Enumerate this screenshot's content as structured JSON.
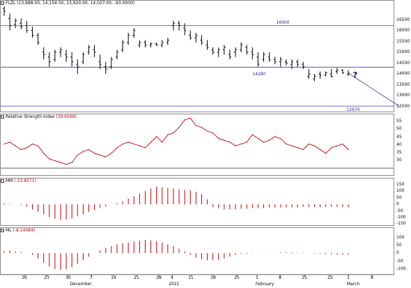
{
  "panels": [
    {
      "title_label": "FLZL",
      "title_value": "(13,988.00, 14,154.50, 13,920.00, 14,027.00, -93.0000)",
      "y_ticks": [
        "16500",
        "16000",
        "15500",
        "15000",
        "14500",
        "14000",
        "13500",
        "13000",
        "12500"
      ]
    },
    {
      "title_label": "Relative Strength Index",
      "title_value": "(39.6568)",
      "y_ticks": [
        "55",
        "50",
        "45",
        "40",
        "35",
        "30"
      ]
    },
    {
      "title_label": "MM",
      "title_value": "(-23.8571)",
      "y_ticks": [
        "150",
        "100",
        "50",
        "0",
        "-50",
        "-100",
        "-150"
      ]
    },
    {
      "title_label": "ML",
      "title_value": "(-8.14084)",
      "y_ticks": [
        "100",
        "50",
        "0",
        "-50",
        "-100"
      ]
    }
  ],
  "x_tick_labels": [
    "16",
    "23",
    "30",
    "7",
    "14",
    "21",
    "28",
    "4",
    "11",
    "18",
    "25",
    "1",
    "8",
    "15",
    "22",
    "1",
    "8"
  ],
  "month_labels": [
    "December",
    "2021",
    "February",
    "March"
  ],
  "annotations": {
    "level_high": "16000",
    "level_mid": "14280",
    "target": "12670",
    "question": "?"
  },
  "colors": {
    "price_bars": "#000000",
    "level_lines": "#3a3aa8",
    "rsi_line": "#c00000",
    "histogram": "#c00000",
    "annotation_text": "#1f1fa0",
    "question_mark": "#000080",
    "trend_line": "#3a3aa8"
  },
  "chart_data": [
    {
      "type": "ohlc",
      "title": "FLZL",
      "ylim": [
        12500,
        16800
      ],
      "x_index_range": [
        0,
        61
      ],
      "ohlc": [
        [
          16700,
          16850,
          16400,
          16600
        ],
        [
          16300,
          16500,
          15800,
          16000
        ],
        [
          16050,
          16300,
          15900,
          16200
        ],
        [
          16100,
          16300,
          15850,
          15950
        ],
        [
          16000,
          16200,
          15700,
          15800
        ],
        [
          15800,
          15950,
          15500,
          15600
        ],
        [
          15600,
          15700,
          15200,
          15300
        ],
        [
          14900,
          15100,
          14600,
          14800
        ],
        [
          14700,
          14900,
          14300,
          14500
        ],
        [
          14600,
          15000,
          14500,
          14900
        ],
        [
          14900,
          15100,
          14700,
          15000
        ],
        [
          14800,
          15000,
          14500,
          14700
        ],
        [
          14700,
          14900,
          14300,
          14500
        ],
        [
          14400,
          14600,
          14000,
          14300
        ],
        [
          14500,
          14900,
          14400,
          14800
        ],
        [
          14900,
          15200,
          14800,
          15100
        ],
        [
          15000,
          15200,
          14700,
          14900
        ],
        [
          14500,
          14800,
          14200,
          14400
        ],
        [
          14300,
          14500,
          14000,
          14200
        ],
        [
          14300,
          14700,
          14200,
          14600
        ],
        [
          14700,
          15000,
          14600,
          14900
        ],
        [
          15000,
          15400,
          14900,
          15300
        ],
        [
          15300,
          15700,
          15200,
          15600
        ],
        [
          15600,
          15900,
          15500,
          15800
        ],
        [
          15200,
          15400,
          15100,
          15300
        ],
        [
          15300,
          15400,
          15100,
          15200
        ],
        [
          15200,
          15300,
          15100,
          15250
        ],
        [
          15250,
          15300,
          15150,
          15200
        ],
        [
          15200,
          15400,
          15100,
          15300
        ],
        [
          15300,
          15500,
          15200,
          15400
        ],
        [
          16000,
          16200,
          15800,
          16100
        ],
        [
          16100,
          16200,
          15800,
          16000
        ],
        [
          15900,
          16100,
          15600,
          15800
        ],
        [
          15600,
          15800,
          15400,
          15500
        ],
        [
          15500,
          15700,
          15300,
          15600
        ],
        [
          15400,
          15600,
          15200,
          15300
        ],
        [
          15200,
          15400,
          15000,
          15100
        ],
        [
          15000,
          15100,
          14800,
          14900
        ],
        [
          14900,
          15100,
          14700,
          15000
        ],
        [
          15000,
          15200,
          14800,
          15100
        ],
        [
          14800,
          15000,
          14600,
          14700
        ],
        [
          14900,
          15100,
          14700,
          15000
        ],
        [
          15000,
          15300,
          14900,
          15200
        ],
        [
          15100,
          15200,
          14800,
          14900
        ],
        [
          14900,
          15100,
          14600,
          14800
        ],
        [
          14700,
          14900,
          14300,
          14400
        ],
        [
          14600,
          14900,
          14500,
          14800
        ],
        [
          14700,
          14900,
          14500,
          14600
        ],
        [
          14600,
          14700,
          14400,
          14500
        ],
        [
          14500,
          14700,
          14300,
          14600
        ],
        [
          14500,
          14600,
          14350,
          14450
        ],
        [
          14400,
          14600,
          14200,
          14500
        ],
        [
          14500,
          14600,
          14300,
          14400
        ],
        [
          14400,
          14500,
          14200,
          14300
        ],
        [
          13900,
          14200,
          13800,
          14000
        ],
        [
          13800,
          14000,
          13700,
          13900
        ],
        [
          14000,
          14100,
          13800,
          13950
        ],
        [
          13950,
          14100,
          13900,
          14050
        ],
        [
          14000,
          14200,
          13850,
          13900
        ],
        [
          14100,
          14250,
          14000,
          14150
        ],
        [
          14150,
          14200,
          14000,
          14050
        ],
        [
          13988,
          14154.5,
          13920,
          14027
        ]
      ],
      "horizontal_levels": [
        16000,
        14280,
        12670
      ],
      "trend_projection": [
        [
          61,
          14027
        ],
        [
          70,
          12670
        ]
      ]
    },
    {
      "type": "line",
      "title": "Relative Strength Index",
      "ylim": [
        27,
        56
      ],
      "x_index_range": [
        0,
        61
      ],
      "values": [
        43,
        44,
        42,
        40,
        41,
        43,
        42,
        38,
        35,
        34,
        33,
        32,
        33,
        37,
        39,
        40,
        38,
        37,
        36,
        38,
        41,
        43,
        44,
        43,
        42,
        41,
        44,
        47,
        44,
        48,
        49,
        52,
        56,
        57,
        53,
        52,
        50,
        49,
        46,
        45,
        44,
        42,
        43,
        44,
        48,
        46,
        44,
        45,
        47,
        46,
        43,
        42,
        41,
        40,
        43,
        42,
        40,
        38,
        41,
        42,
        43,
        40
      ]
    },
    {
      "type": "bar",
      "title": "MM",
      "ylim": [
        -160,
        160
      ],
      "x_index_range": [
        0,
        61
      ],
      "values": [
        10,
        5,
        0,
        -5,
        -20,
        -40,
        -60,
        -80,
        -100,
        -115,
        -125,
        -120,
        -110,
        -95,
        -80,
        -60,
        -45,
        -30,
        -15,
        0,
        10,
        25,
        45,
        65,
        85,
        105,
        125,
        140,
        135,
        130,
        125,
        120,
        115,
        110,
        100,
        80,
        40,
        -20,
        -30,
        -40,
        -40,
        -40,
        -35,
        -35,
        -30,
        -30,
        -30,
        -25,
        -25,
        -25,
        -25,
        -25,
        -25,
        -20,
        -20,
        -22,
        -24,
        -22,
        -20,
        -20,
        -20,
        -23.86
      ]
    },
    {
      "type": "bar",
      "title": "ML",
      "ylim": [
        -110,
        110
      ],
      "x_index_range": [
        0,
        61
      ],
      "values": [
        10,
        15,
        10,
        5,
        0,
        -10,
        -30,
        -55,
        -75,
        -90,
        -95,
        -90,
        -80,
        -60,
        -40,
        -20,
        0,
        15,
        30,
        40,
        50,
        55,
        60,
        65,
        70,
        75,
        72,
        68,
        60,
        50,
        40,
        25,
        10,
        -10,
        -25,
        -35,
        -40,
        -40,
        -38,
        -30,
        -20,
        -10,
        -5,
        -3,
        -2,
        -1,
        0,
        1,
        2,
        3,
        4,
        5,
        3,
        2,
        0,
        -2,
        -4,
        -6,
        -7,
        -8,
        -8,
        -8.14
      ]
    }
  ]
}
